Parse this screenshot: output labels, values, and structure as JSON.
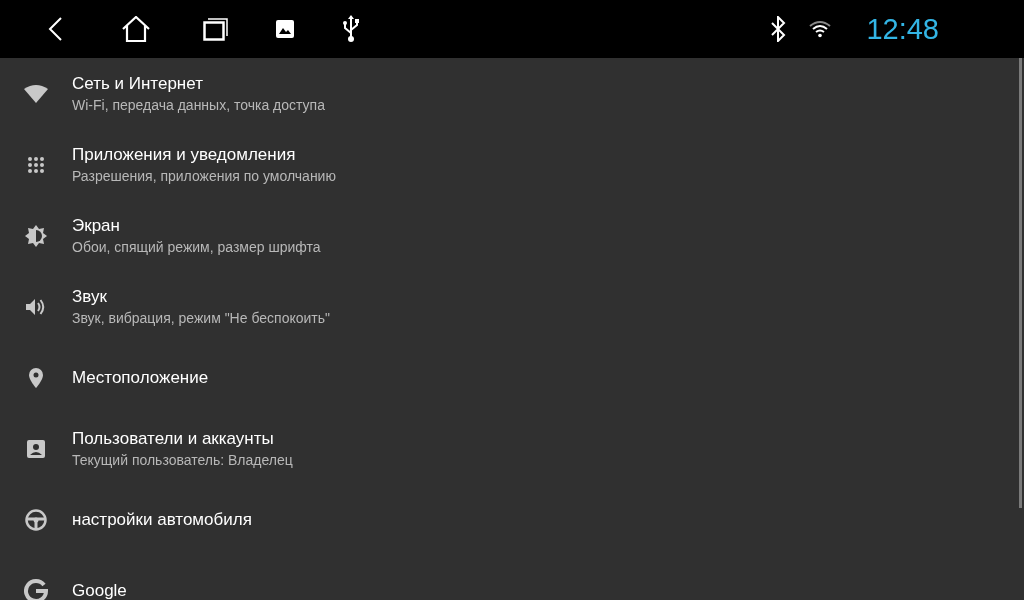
{
  "status_bar": {
    "time": "12:48"
  },
  "settings": [
    {
      "title": "Сеть и Интернет",
      "subtitle": "Wi-Fi, передача данных, точка доступа"
    },
    {
      "title": "Приложения и уведомления",
      "subtitle": "Разрешения, приложения по умолчанию"
    },
    {
      "title": "Экран",
      "subtitle": "Обои, спящий режим, размер шрифта"
    },
    {
      "title": "Звук",
      "subtitle": "Звук, вибрация, режим \"Не беспокоить\""
    },
    {
      "title": "Местоположение"
    },
    {
      "title": "Пользователи и аккаунты",
      "subtitle": "Текущий пользователь: Владелец"
    },
    {
      "title": "настройки автомобиля"
    },
    {
      "title": "Google"
    }
  ]
}
